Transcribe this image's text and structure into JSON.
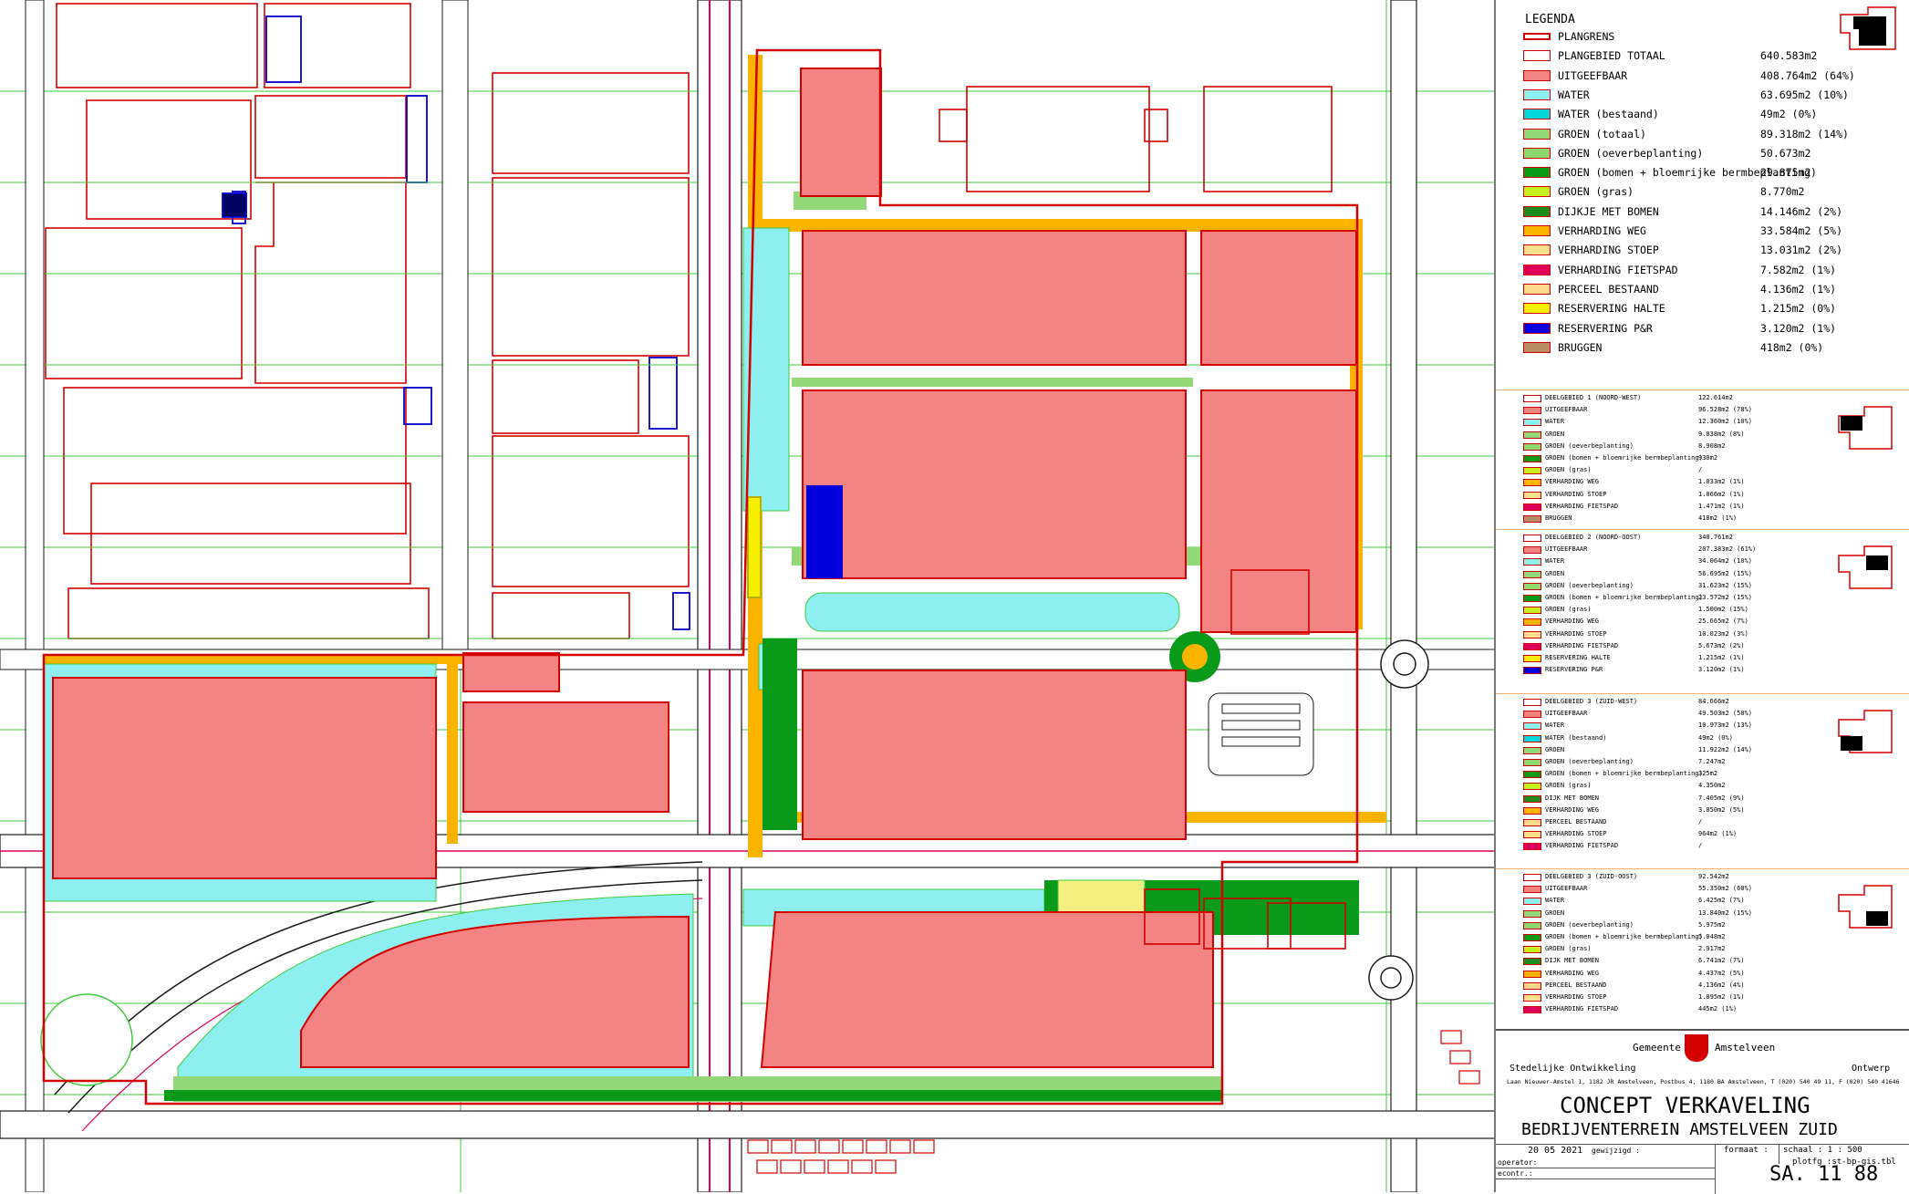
{
  "legend": {
    "title": "LEGENDA",
    "items": [
      {
        "label": "PLANGRENS",
        "value": "",
        "color": "#ffffff",
        "border": "#d40000",
        "line": true
      },
      {
        "label": "PLANGEBIED TOTAAL",
        "value": "640.583m2",
        "color": "#ffffff",
        "border": "#d40000"
      },
      {
        "label": "UITGEEFBAAR",
        "value": "408.764m2 (64%)",
        "color": "#f48484",
        "border": "#d40000"
      },
      {
        "label": "WATER",
        "value": "63.695m2 (10%)",
        "color": "#8deff0",
        "border": "#d40000"
      },
      {
        "label": "WATER (bestaand)",
        "value": "49m2 (0%)",
        "color": "#00d8dc",
        "border": "#d40000"
      },
      {
        "label": "GROEN (totaal)",
        "value": "89.318m2 (14%)",
        "color": "#92d878",
        "border": "#d40000"
      },
      {
        "label": "GROEN (oeverbeplanting)",
        "value": "50.673m2",
        "color": "#8ed870",
        "border": "#d40000"
      },
      {
        "label": "GROEN (bomen + bloemrijke bermbeplanting)",
        "value": "29.875m2",
        "color": "#089a18",
        "border": "#d40000"
      },
      {
        "label": "GROEN (gras)",
        "value": "8.770m2",
        "color": "#c6f01e",
        "border": "#d40000"
      },
      {
        "label": "DIJKJE MET BOMEN",
        "value": "14.146m2 (2%)",
        "color": "#1e8c1e",
        "border": "#d40000"
      },
      {
        "label": "VERHARDING WEG",
        "value": "33.584m2 (5%)",
        "color": "#fab400",
        "border": "#d40000"
      },
      {
        "label": "VERHARDING STOEP",
        "value": "13.031m2 (2%)",
        "color": "#fbe08e",
        "border": "#d40000"
      },
      {
        "label": "VERHARDING FIETSPAD",
        "value": "7.582m2 (1%)",
        "color": "#dc005a",
        "border": "#d40000"
      },
      {
        "label": "PERCEEL BESTAAND",
        "value": "4.136m2 (1%)",
        "color": "#fcd98c",
        "border": "#d40000"
      },
      {
        "label": "RESERVERING HALTE",
        "value": "1.215m2 (0%)",
        "color": "#f6f000",
        "border": "#d40000"
      },
      {
        "label": "RESERVERING P&R",
        "value": "3.120m2 (1%)",
        "color": "#0000dc",
        "border": "#d40000"
      },
      {
        "label": "BRUGGEN",
        "value": "418m2 (0%)",
        "color": "#b88c64",
        "border": "#d40000"
      }
    ]
  },
  "subareas": [
    {
      "items": [
        {
          "label": "DEELGEBIED 1 (NOORD-WEST)",
          "value": "122.614m2",
          "color": "#ffffff"
        },
        {
          "label": "UITGEEFBAAR",
          "value": "96.528m2 (78%)",
          "color": "#f48484"
        },
        {
          "label": "WATER",
          "value": "12.360m2 (10%)",
          "color": "#8deff0"
        },
        {
          "label": "GROEN",
          "value": "9.838m2 (8%)",
          "color": "#92d878"
        },
        {
          "label": "GROEN (oeverbeplanting)",
          "value": "8.908m2",
          "color": "#8ed870"
        },
        {
          "label": "GROEN (bomen + bloemrijke bermbeplanting)",
          "value": "930m2",
          "color": "#089a18"
        },
        {
          "label": "GROEN (gras)",
          "value": "/",
          "color": "#c6f01e"
        },
        {
          "label": "VERHARDING WEG",
          "value": "1.033m2 (1%)",
          "color": "#fab400"
        },
        {
          "label": "VERHARDING STOEP",
          "value": "1.066m2 (1%)",
          "color": "#fbe08e"
        },
        {
          "label": "VERHARDING FIETSPAD",
          "value": "1.471m2 (1%)",
          "color": "#dc005a"
        },
        {
          "label": "BRUGGEN",
          "value": "418m2 (1%)",
          "color": "#b88c64"
        }
      ]
    },
    {
      "items": [
        {
          "label": "DEELGEBIED 2 (NOORD-OOST)",
          "value": "340.761m2",
          "color": "#ffffff"
        },
        {
          "label": "UITGEEFBAAR",
          "value": "207.383m2 (61%)",
          "color": "#f48484"
        },
        {
          "label": "WATER",
          "value": "34.064m2 (10%)",
          "color": "#8deff0"
        },
        {
          "label": "GROEN",
          "value": "56.695m2 (15%)",
          "color": "#92d878"
        },
        {
          "label": "GROEN (oeverbeplanting)",
          "value": "31.623m2 (15%)",
          "color": "#8ed870"
        },
        {
          "label": "GROEN (bomen + bloemrijke bermbeplanting)",
          "value": "23.572m2 (15%)",
          "color": "#089a18"
        },
        {
          "label": "GROEN (gras)",
          "value": "1.500m2 (15%)",
          "color": "#c6f01e"
        },
        {
          "label": "VERHARDING WEG",
          "value": "25.665m2 (7%)",
          "color": "#fab400"
        },
        {
          "label": "VERHARDING STOEP",
          "value": "10.023m2 (3%)",
          "color": "#fbe08e"
        },
        {
          "label": "VERHARDING FIETSPAD",
          "value": "5.673m2 (2%)",
          "color": "#dc005a"
        },
        {
          "label": "RESERVERING HALTE",
          "value": "1.215m2 (1%)",
          "color": "#f6f000"
        },
        {
          "label": "RESERVERING P&R",
          "value": "3.120m2 (1%)",
          "color": "#0000dc"
        }
      ]
    },
    {
      "items": [
        {
          "label": "DEELGEBIED 3 (ZUID-WEST)",
          "value": "84.666m2",
          "color": "#ffffff"
        },
        {
          "label": "UITGEEFBAAR",
          "value": "49.503m2 (58%)",
          "color": "#f48484"
        },
        {
          "label": "WATER",
          "value": "10.973m2 (13%)",
          "color": "#8deff0"
        },
        {
          "label": "WATER (bestaand)",
          "value": "49m2 (0%)",
          "color": "#00d8dc"
        },
        {
          "label": "GROEN",
          "value": "11.922m2 (14%)",
          "color": "#92d878"
        },
        {
          "label": "GROEN (oeverbeplanting)",
          "value": "7.247m2",
          "color": "#8ed870"
        },
        {
          "label": "GROEN (bomen + bloemrijke bermbeplanting)",
          "value": "325m2",
          "color": "#089a18"
        },
        {
          "label": "GROEN (gras)",
          "value": "4.350m2",
          "color": "#c6f01e"
        },
        {
          "label": "DIJK MET BOMEN",
          "value": "7.405m2 (9%)",
          "color": "#1e8c1e"
        },
        {
          "label": "VERHARDING WEG",
          "value": "3.850m2 (5%)",
          "color": "#fab400"
        },
        {
          "label": "PERCEEL BESTAAND",
          "value": "/",
          "color": "#fcd98c"
        },
        {
          "label": "VERHARDING STOEP",
          "value": "964m2 (1%)",
          "color": "#fbe08e"
        },
        {
          "label": "VERHARDING FIETSPAD",
          "value": "/",
          "color": "#dc005a"
        }
      ]
    },
    {
      "items": [
        {
          "label": "DEELGEBIED 3 (ZUID-OOST)",
          "value": "92.542m2",
          "color": "#ffffff"
        },
        {
          "label": "UITGEEFBAAR",
          "value": "55.350m2 (60%)",
          "color": "#f48484"
        },
        {
          "label": "WATER",
          "value": "6.425m2 (7%)",
          "color": "#8deff0"
        },
        {
          "label": "GROEN",
          "value": "13.840m2 (15%)",
          "color": "#92d878"
        },
        {
          "label": "GROEN (oeverbeplanting)",
          "value": "5.975m2",
          "color": "#8ed870"
        },
        {
          "label": "GROEN (bomen + bloemrijke bermbeplanting)",
          "value": "5.048m2",
          "color": "#089a18"
        },
        {
          "label": "GROEN (gras)",
          "value": "2.917m2",
          "color": "#c6f01e"
        },
        {
          "label": "DIJK MET BOMEN",
          "value": "6.741m2 (7%)",
          "color": "#1e8c1e"
        },
        {
          "label": "VERHARDING WEG",
          "value": "4.437m2 (5%)",
          "color": "#fab400"
        },
        {
          "label": "PERCEEL BESTAAND",
          "value": "4.136m2 (4%)",
          "color": "#fcd98c"
        },
        {
          "label": "VERHARDING STOEP",
          "value": "1.095m2 (1%)",
          "color": "#fbe08e"
        },
        {
          "label": "VERHARDING FIETSPAD",
          "value": "445m2 (1%)",
          "color": "#dc005a"
        }
      ]
    }
  ],
  "titleblock": {
    "municipality_left": "Gemeente",
    "municipality_right": "Amstelveen",
    "department": "Stedelijke Ontwikkeling",
    "discipline": "Ontwerp",
    "address": "Laan Nieuwer-Amstel 1, 1182 JR Amstelveen, Postbus 4, 1180 BA Amstelveen, T (020) 540 49 11, F (020) 540 41646",
    "title": "CONCEPT VERKAVELING",
    "subtitle": "BEDRIJVENTERREIN AMSTELVEEN ZUID",
    "date": "20 05 2021",
    "revised": "gewijzigd :",
    "format": "formaat :",
    "scale": "schaal : 1 : 500",
    "plotfile": "plotfg :st-bp-gis.tbl",
    "operator": "operator:",
    "econtr": "econtr.:",
    "drawing_number": "SA. 11 88"
  },
  "colors": {
    "plot": "#f48484",
    "plot_border": "#d40000",
    "water": "#8deff0",
    "green": "#92d878",
    "green_dark": "#089a18",
    "road": "#fab400",
    "sidewalk": "#fbe08e",
    "cycle": "#dc005a",
    "pr": "#0000dc",
    "halte": "#f6f000",
    "grass": "#c6f01e",
    "line_green": "#3ccc3c"
  }
}
